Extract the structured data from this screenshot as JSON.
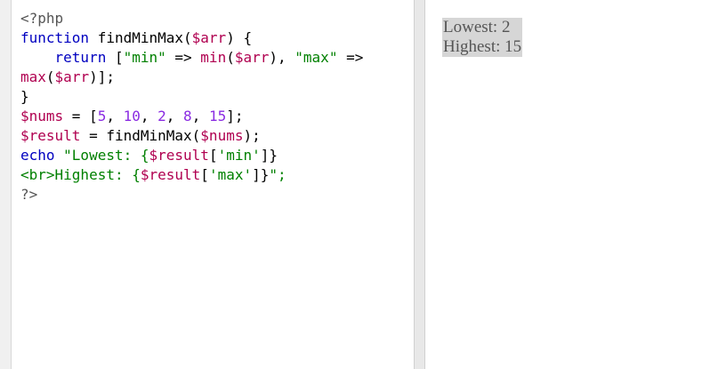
{
  "editor": {
    "lines": [
      [
        {
          "t": "<?php",
          "c": "php"
        }
      ],
      [
        {
          "t": "function",
          "c": "kw"
        },
        {
          "t": " findMinMax(",
          "c": "plain"
        },
        {
          "t": "$arr",
          "c": "var"
        },
        {
          "t": ") {",
          "c": "plain"
        }
      ],
      [
        {
          "t": "    ",
          "c": "plain"
        },
        {
          "t": "return",
          "c": "kw"
        },
        {
          "t": " [",
          "c": "plain"
        },
        {
          "t": "\"min\"",
          "c": "str"
        },
        {
          "t": " => ",
          "c": "plain"
        },
        {
          "t": "min",
          "c": "var"
        },
        {
          "t": "(",
          "c": "plain"
        },
        {
          "t": "$arr",
          "c": "var"
        },
        {
          "t": "), ",
          "c": "plain"
        },
        {
          "t": "\"max\"",
          "c": "str"
        },
        {
          "t": " =>",
          "c": "plain"
        }
      ],
      [
        {
          "t": "max",
          "c": "var"
        },
        {
          "t": "(",
          "c": "plain"
        },
        {
          "t": "$arr",
          "c": "var"
        },
        {
          "t": ")];",
          "c": "plain"
        }
      ],
      [
        {
          "t": "}",
          "c": "plain"
        }
      ],
      [
        {
          "t": "$nums",
          "c": "var"
        },
        {
          "t": " = [",
          "c": "plain"
        },
        {
          "t": "5",
          "c": "num"
        },
        {
          "t": ", ",
          "c": "plain"
        },
        {
          "t": "10",
          "c": "num"
        },
        {
          "t": ", ",
          "c": "plain"
        },
        {
          "t": "2",
          "c": "num"
        },
        {
          "t": ", ",
          "c": "plain"
        },
        {
          "t": "8",
          "c": "num"
        },
        {
          "t": ", ",
          "c": "plain"
        },
        {
          "t": "15",
          "c": "num"
        },
        {
          "t": "];",
          "c": "plain"
        }
      ],
      [
        {
          "t": "$result",
          "c": "var"
        },
        {
          "t": " = findMinMax(",
          "c": "plain"
        },
        {
          "t": "$nums",
          "c": "var"
        },
        {
          "t": ");",
          "c": "plain"
        }
      ],
      [
        {
          "t": "echo",
          "c": "kw"
        },
        {
          "t": " \"Lowest: {",
          "c": "str"
        },
        {
          "t": "$result",
          "c": "var"
        },
        {
          "t": "[",
          "c": "plain"
        },
        {
          "t": "'min'",
          "c": "str"
        },
        {
          "t": "]}",
          "c": "plain"
        }
      ],
      [
        {
          "t": "<br>Highest: {",
          "c": "br"
        },
        {
          "t": "$result",
          "c": "var"
        },
        {
          "t": "[",
          "c": "plain"
        },
        {
          "t": "'max'",
          "c": "str"
        },
        {
          "t": "]}",
          "c": "plain"
        },
        {
          "t": "\";",
          "c": "str"
        }
      ],
      [
        {
          "t": "?>",
          "c": "php"
        }
      ]
    ]
  },
  "output": {
    "line1": "Lowest: 2",
    "line2": "Highest: 15"
  }
}
